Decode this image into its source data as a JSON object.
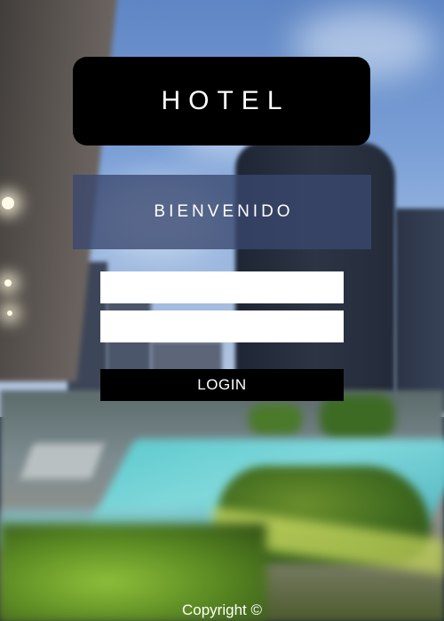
{
  "header": {
    "title": "HOTEL"
  },
  "welcome": {
    "text": "BIENVENIDO"
  },
  "form": {
    "username_value": "",
    "password_value": "",
    "login_label": "LOGIN"
  },
  "footer": {
    "copyright": "Copyright ©"
  },
  "colors": {
    "title_bg": "#000000",
    "welcome_bg": "#3a486e",
    "button_bg": "#000000",
    "text": "#ffffff"
  }
}
